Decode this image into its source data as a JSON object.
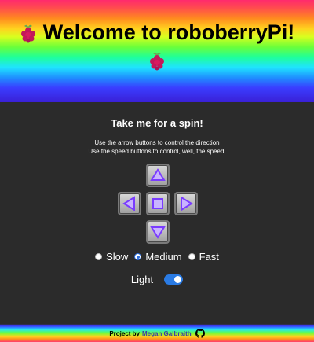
{
  "header": {
    "title": "Welcome to roboberryPi!",
    "icon": "raspberry-icon"
  },
  "main": {
    "subtitle": "Take me for a spin!",
    "instructions": [
      "Use the arrow buttons to control the direction",
      "Use the speed buttons to control, well, the speed."
    ]
  },
  "controls": {
    "buttons": [
      "up-arrow-icon",
      "left-arrow-icon",
      "stop-icon",
      "right-arrow-icon",
      "down-arrow-icon"
    ],
    "accent": "#7a3cff"
  },
  "speed": {
    "options": [
      "Slow",
      "Medium",
      "Fast"
    ],
    "selected": "Medium"
  },
  "light": {
    "label": "Light",
    "on": true
  },
  "footer": {
    "prefix": "Project by",
    "author": "Megan Galbraith",
    "icon": "github-icon"
  }
}
